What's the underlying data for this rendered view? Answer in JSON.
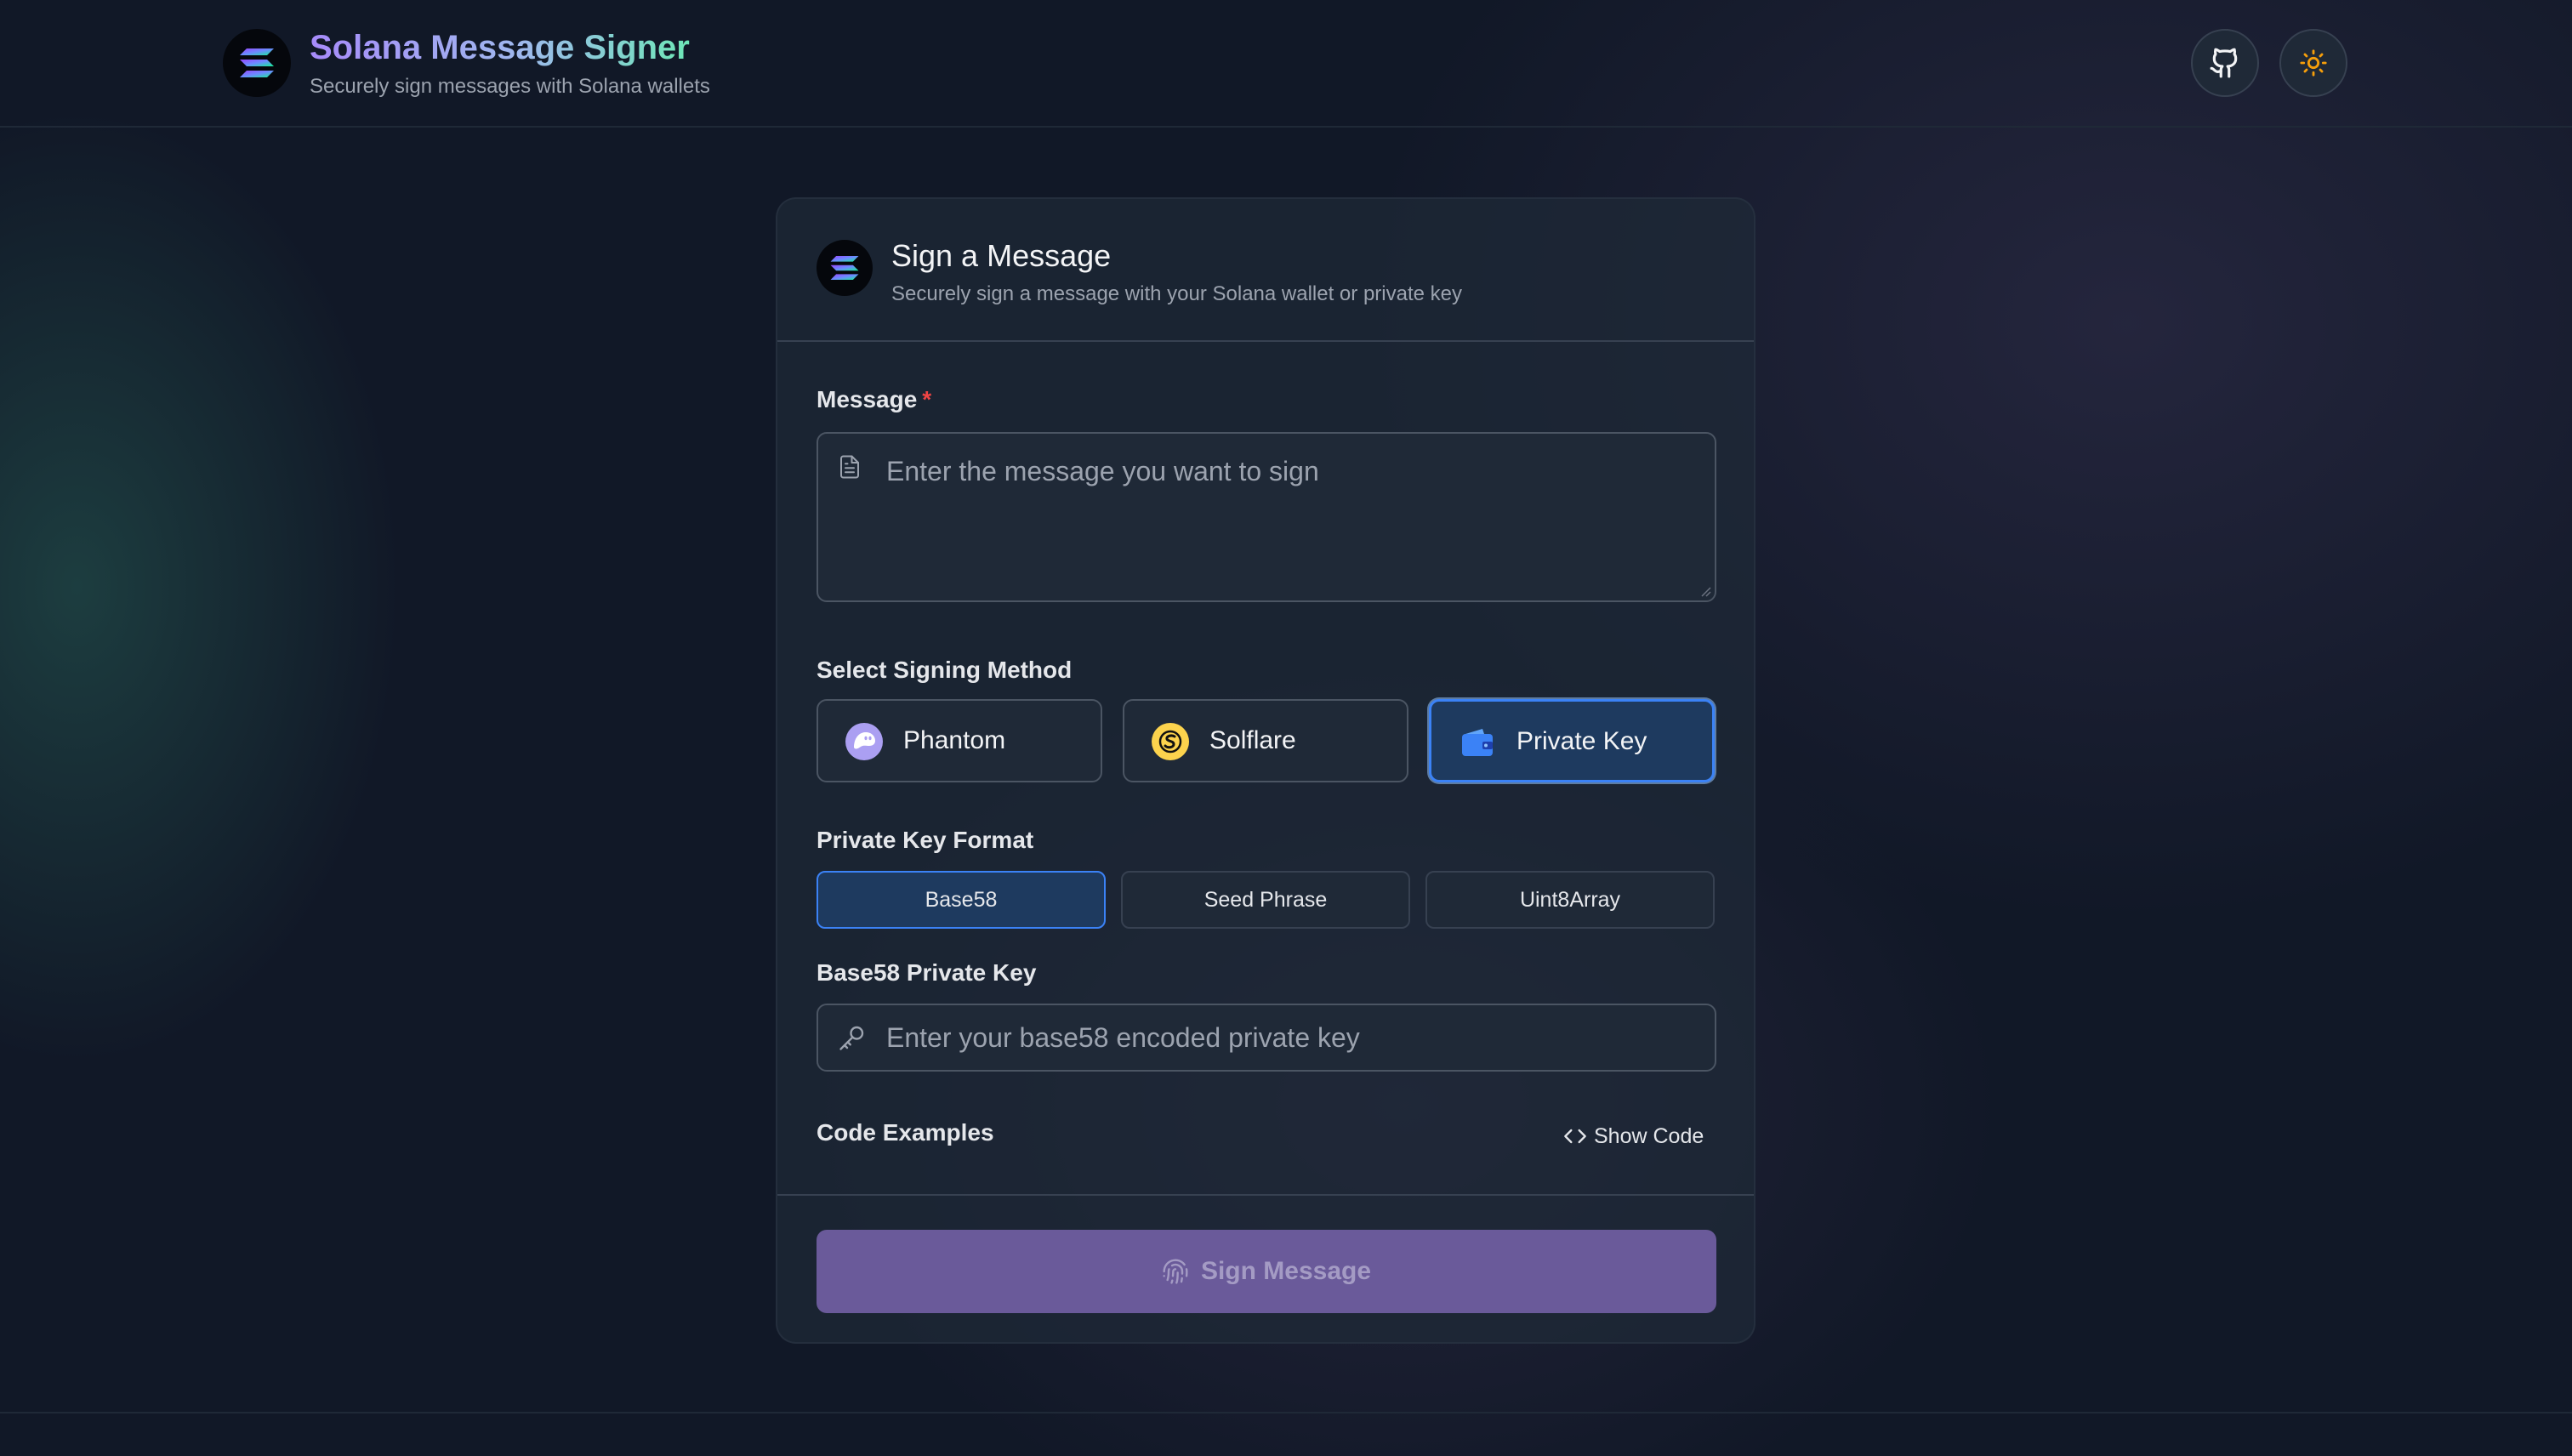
{
  "header": {
    "title": "Solana Message Signer",
    "subtitle": "Securely sign messages with Solana wallets",
    "logo_icon": "solana-logo-icon",
    "github_icon": "github-icon",
    "theme_icon": "sun-icon"
  },
  "card": {
    "title": "Sign a Message",
    "subtitle": "Securely sign a message with your Solana wallet or private key"
  },
  "message": {
    "label": "Message",
    "required_mark": "*",
    "value": "",
    "placeholder": "Enter the message you want to sign"
  },
  "signing_method": {
    "label": "Select Signing Method",
    "selected": "Private Key",
    "options": [
      {
        "label": "Phantom",
        "icon": "phantom-icon"
      },
      {
        "label": "Solflare",
        "icon": "solflare-icon"
      },
      {
        "label": "Private Key",
        "icon": "wallet-icon"
      }
    ]
  },
  "key_format": {
    "label": "Private Key Format",
    "selected": "Base58",
    "options": [
      "Base58",
      "Seed Phrase",
      "Uint8Array"
    ]
  },
  "private_key": {
    "label": "Base58 Private Key",
    "value": "",
    "placeholder": "Enter your base58 encoded private key"
  },
  "code_examples": {
    "label": "Code Examples",
    "toggle_label": "Show Code"
  },
  "sign_button": {
    "label": "Sign Message",
    "icon": "fingerprint-icon",
    "disabled": true
  },
  "colors": {
    "background": "#111827",
    "card": "#1f2937",
    "accent_blue": "#3b82f6",
    "sign_button": "#6a5a9a",
    "required": "#ef4444"
  }
}
